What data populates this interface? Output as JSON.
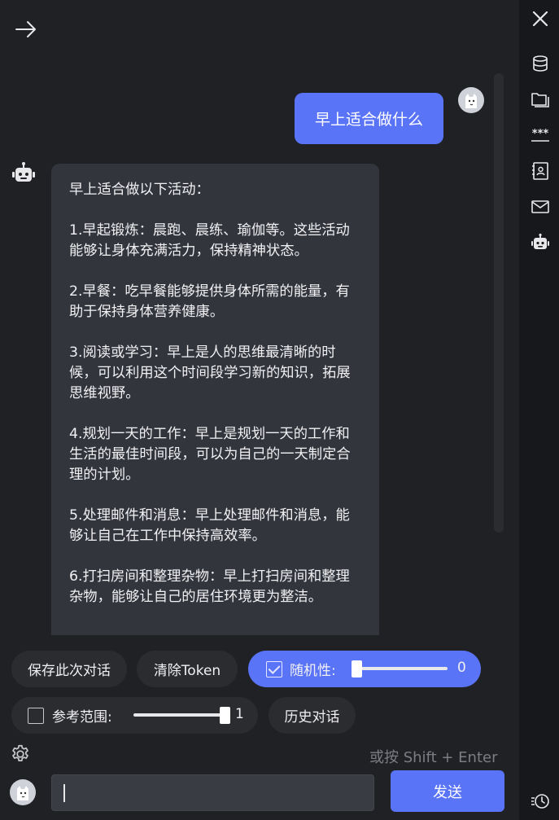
{
  "nav": {
    "back_icon": "arrow-right-icon"
  },
  "chat": {
    "user_message": "早上适合做什么",
    "bot_message": "早上适合做以下活动：\n\n1.早起锻炼：晨跑、晨练、瑜伽等。这些活动能够让身体充满活力，保持精神状态。\n\n2.早餐：吃早餐能够提供身体所需的能量，有助于保持身体营养健康。\n\n3.阅读或学习：早上是人的思维最清晰的时候，可以利用这个时间段学习新的知识，拓展思维视野。\n\n4.规划一天的工作：早上是规划一天的工作和生活的最佳时间段，可以为自己的一天制定合理的计划。\n\n5.处理邮件和消息：早上处理邮件和消息，能够让自己在工作中保持高效率。\n\n6.打扫房间和整理杂物：早上打扫房间和整理杂物，能够让自己的居住环境更为整洁。"
  },
  "controls": {
    "save_label": "保存此次对话",
    "clear_label": "清除Token",
    "randomness_label": "随机性:",
    "randomness_value": "0",
    "randomness_checked": true,
    "randomness_level": 0,
    "reference_label": "参考范围:",
    "reference_value": "1",
    "reference_checked": false,
    "reference_level": 1,
    "history_label": "历史对话"
  },
  "input": {
    "hint": "或按 Shift + Enter",
    "value": "",
    "send_label": "发送"
  },
  "sidebar": {
    "close_icon": "close-icon",
    "items": [
      "database-icon",
      "folder-icon",
      "password-icon",
      "contacts-icon",
      "mail-icon",
      "robot-icon"
    ],
    "history_icon": "history-clock-icon"
  },
  "colors": {
    "accent": "#5a74f7",
    "background": "#202124",
    "bubble": "#33353d"
  }
}
